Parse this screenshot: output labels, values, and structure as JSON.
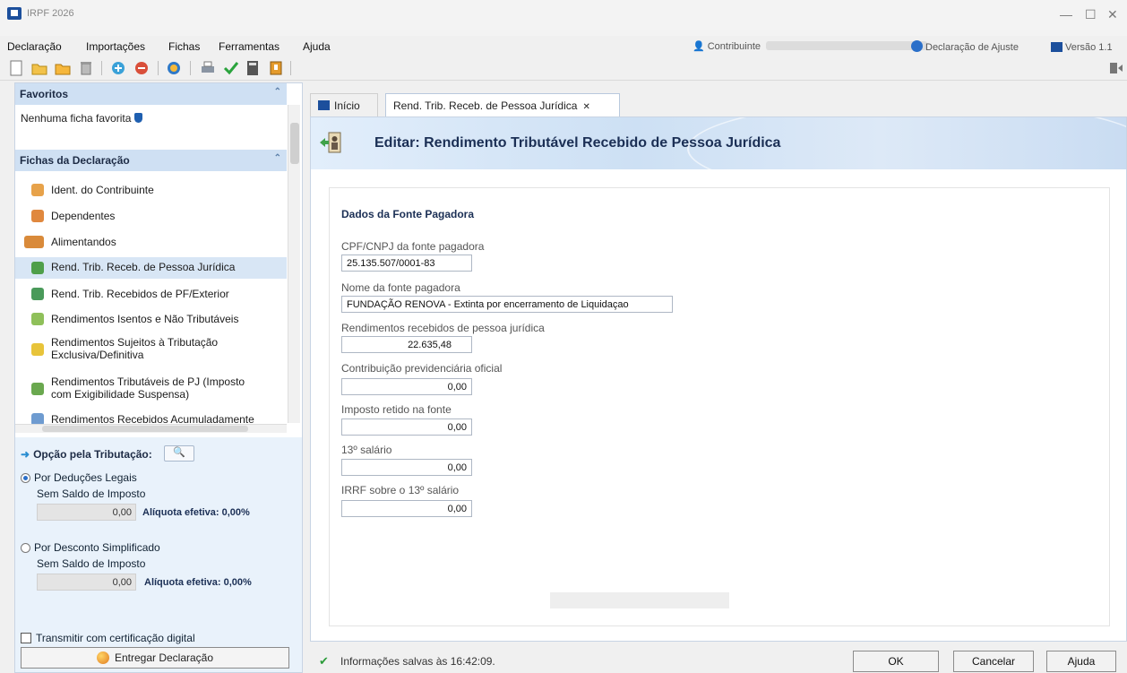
{
  "window": {
    "title": "IRPF 2026"
  },
  "menu": [
    "Declaração",
    "Importações",
    "Fichas",
    "Ferramentas",
    "Ajuda"
  ],
  "header_right": {
    "contribuinte_label": "Contribuinte",
    "declaracao_label": "Declaração de Ajuste",
    "versao_label": "Versão 1.1"
  },
  "favorites": {
    "header": "Favoritos",
    "empty_text": "Nenhuma ficha favorita"
  },
  "fichas": {
    "header": "Fichas da Declaração",
    "items": [
      {
        "label": "Ident. do Contribuinte"
      },
      {
        "label": "Dependentes"
      },
      {
        "label": "Alimentandos"
      },
      {
        "label": "Rend. Trib. Receb. de Pessoa Jurídica"
      },
      {
        "label": "Rend. Trib. Recebidos de PF/Exterior"
      },
      {
        "label": "Rendimentos Isentos e Não Tributáveis"
      },
      {
        "label": "Rendimentos Sujeitos à Tributação Exclusiva/Definitiva"
      },
      {
        "label": "Rendimentos Tributáveis de PJ (Imposto com Exigibilidade Suspensa)"
      },
      {
        "label": "Rendimentos Recebidos Acumuladamente"
      }
    ]
  },
  "tax_option": {
    "header": "Opção pela Tributação:",
    "legal": {
      "label": "Por Deduções Legais",
      "status": "Sem Saldo de Imposto",
      "value": "0,00",
      "rate": "Alíquota efetiva: 0,00%"
    },
    "simplified": {
      "label": "Por Desconto Simplificado",
      "status": "Sem Saldo de Imposto",
      "value": "0,00",
      "rate": "Alíquota efetiva: 0,00%"
    },
    "cert_label": "Transmitir com certificação digital",
    "deliver_label": "Entregar Declaração"
  },
  "tabs": {
    "home": "Início",
    "active": "Rend. Trib. Receb. de Pessoa Jurídica"
  },
  "editor": {
    "title": "Editar: Rendimento Tributável Recebido de Pessoa Jurídica",
    "section": "Dados da Fonte Pagadora",
    "fields": {
      "cpf_label": "CPF/CNPJ da fonte pagadora",
      "cpf_value": "25.135.507/0001-83",
      "nome_label": "Nome da fonte pagadora",
      "nome_value": "FUNDAÇÃO RENOVA - Extinta por encerramento de Liquidaçao",
      "rend_label": "Rendimentos recebidos de pessoa jurídica",
      "rend_value": "22.635,48",
      "contrib_label": "Contribuição previdenciária oficial",
      "contrib_value": "0,00",
      "imposto_label": "Imposto retido na fonte",
      "imposto_value": "0,00",
      "decimo_label": "13º salário",
      "decimo_value": "0,00",
      "irrf_label": "IRRF sobre o 13º salário",
      "irrf_value": "0,00"
    }
  },
  "status": {
    "saved_text": "Informações salvas às 16:42:09."
  },
  "buttons": {
    "ok": "OK",
    "cancel": "Cancelar",
    "help": "Ajuda"
  }
}
